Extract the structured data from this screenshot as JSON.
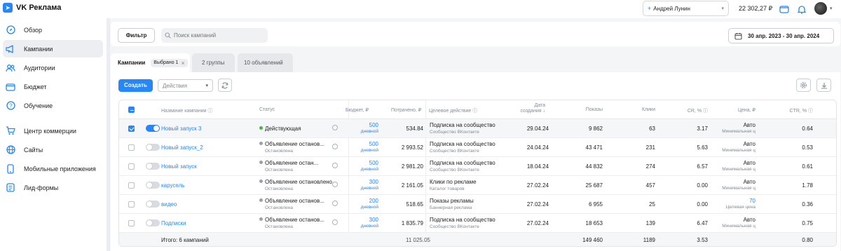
{
  "app": {
    "title": "VK Реклама",
    "account_name": "Андрей Лунин",
    "balance": "22 302,27 ₽"
  },
  "sidebar": {
    "items": [
      {
        "label": "Обзор",
        "icon": "compass-icon",
        "active": false
      },
      {
        "label": "Кампании",
        "icon": "megaphone-icon",
        "active": true
      },
      {
        "label": "Аудитории",
        "icon": "people-icon",
        "active": false
      },
      {
        "label": "Бюджет",
        "icon": "wallet-icon",
        "active": false
      },
      {
        "label": "Обучение",
        "icon": "question-icon",
        "active": false
      },
      {
        "label": "Центр коммерции",
        "icon": "cart-icon",
        "active": false
      },
      {
        "label": "Сайты",
        "icon": "globe-icon",
        "active": false
      },
      {
        "label": "Мобильные приложения",
        "icon": "phone-icon",
        "active": false
      },
      {
        "label": "Лид-формы",
        "icon": "form-icon",
        "active": false
      }
    ]
  },
  "filterbar": {
    "filter_label": "Фильтр",
    "search_placeholder": "Поиск кампаний",
    "date_range": "30 апр. 2023 - 30 апр. 2024"
  },
  "tabs": {
    "campaigns": "Кампании",
    "selected_chip": "Выбрано 1",
    "groups": "2 группы",
    "ads": "10 объявлений"
  },
  "toolbar": {
    "create_label": "Создать",
    "actions_label": "Действия"
  },
  "table": {
    "headers": {
      "name": "Название кампании",
      "status": "Статус",
      "budget": "Бюджет, ₽",
      "spent": "Потрачено, ₽",
      "target": "Целевое действие",
      "created_1": "Дата",
      "created_2": "создания",
      "impressions": "Показы",
      "clicks": "Клики",
      "cr": "CR, %",
      "price": "Цена, ₽",
      "ctr": "CTR, %"
    },
    "rows": [
      {
        "name": "Новый запуск 3",
        "on": true,
        "checked": true,
        "status": "Действующая",
        "status_sub": "",
        "status_color": "#4bb34b",
        "budget": "500",
        "budget_sub": "дневной",
        "spent": "534.84",
        "target": "Подписка на сообщество",
        "target_sub": "Сообщество ВКонтакте",
        "created": "29.04.24",
        "impressions": "9 862",
        "clicks": "63",
        "cr": "3.17",
        "price": "Авто",
        "price_sub": "Минимальная ц",
        "ctr": "0.64"
      },
      {
        "name": "Новый запуск_2",
        "on": false,
        "checked": false,
        "status": "Объявление останов...",
        "status_sub": "Остановлена",
        "status_color": "#99a2ad",
        "budget": "500",
        "budget_sub": "дневной",
        "spent": "2 993.52",
        "target": "Подписка на сообщество",
        "target_sub": "Сообщество ВКонтакте",
        "created": "24.04.24",
        "impressions": "43 471",
        "clicks": "231",
        "cr": "5.63",
        "price": "Авто",
        "price_sub": "Минимальная ц",
        "ctr": "0.53"
      },
      {
        "name": "Новый запуск",
        "on": false,
        "checked": false,
        "status": "Объявление остан...",
        "status_sub": "Остановлена",
        "status_color": "#99a2ad",
        "budget": "500",
        "budget_sub": "дневной",
        "spent": "2 981.20",
        "target": "Подписка на сообщество",
        "target_sub": "Сообщество ВКонтакте",
        "created": "18.04.24",
        "impressions": "44 832",
        "clicks": "274",
        "cr": "6.57",
        "price": "Авто",
        "price_sub": "Минимальная ц",
        "ctr": "0.61"
      },
      {
        "name": "карусель",
        "on": false,
        "checked": false,
        "status": "Объявление остановлено",
        "status_sub": "Остановлена",
        "status_color": "#99a2ad",
        "budget": "300",
        "budget_sub": "дневной",
        "spent": "2 161.05",
        "target": "Клики по рекламе",
        "target_sub": "Каталог товаров",
        "created": "27.02.24",
        "impressions": "25 687",
        "clicks": "457",
        "cr": "0.00",
        "price": "Авто",
        "price_sub": "Минимальная ц",
        "ctr": "1.78"
      },
      {
        "name": "видео",
        "on": false,
        "checked": false,
        "status": "Объявление останов...",
        "status_sub": "Остановлена",
        "status_color": "#99a2ad",
        "budget": "200",
        "budget_sub": "дневной",
        "spent": "518.65",
        "target": "Показы рекламы",
        "target_sub": "Баннерная реклама",
        "created": "27.02.24",
        "impressions": "6 955",
        "clicks": "25",
        "cr": "0.00",
        "price": "70",
        "price_sub": "Целевая цена",
        "ctr": "0.36"
      },
      {
        "name": "Подписки",
        "on": false,
        "checked": false,
        "status": "Объявление останов...",
        "status_sub": "Остановлена",
        "status_color": "#99a2ad",
        "budget": "300",
        "budget_sub": "дневной",
        "spent": "1 835.79",
        "target": "Подписка на сообщество",
        "target_sub": "Сообщество ВКонтакте",
        "created": "27.02.24",
        "impressions": "18 653",
        "clicks": "139",
        "cr": "6.47",
        "price": "Авто",
        "price_sub": "Минимальная ц",
        "ctr": "0.75"
      }
    ],
    "totals": {
      "label": "Итого: 6 кампаний",
      "spent": "11 025.05",
      "impressions": "149 460",
      "clicks": "1189",
      "cr": "3.53",
      "ctr": "0.80"
    }
  },
  "colors": {
    "accent": "#2787f5",
    "active_status": "#4bb34b",
    "muted": "#818c99"
  }
}
